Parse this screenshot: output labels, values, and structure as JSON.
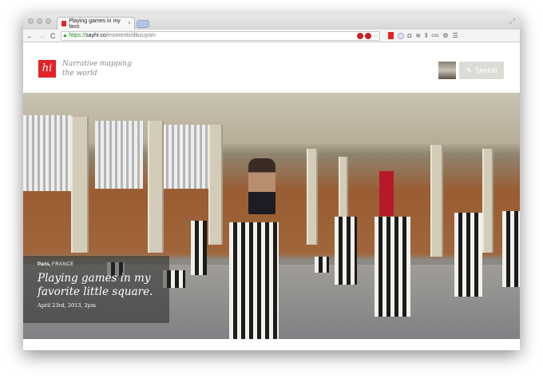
{
  "browser": {
    "tab_title": "Playing games in my favo",
    "tab_close": "×",
    "url_scheme": "https://",
    "url_host": "sayhi.co",
    "url_path": "/moments/dkizuysm",
    "ext_css": "css"
  },
  "header": {
    "logo": "hi",
    "tagline": "Narrative mapping the world",
    "sketch_label": "Sketch"
  },
  "moment": {
    "city": "Paris,",
    "country": "FRANCE",
    "title": "Playing games in my favorite little square.",
    "date": "April 23rd, 2013, 2pm"
  },
  "colors": {
    "brand": "#e22227"
  }
}
